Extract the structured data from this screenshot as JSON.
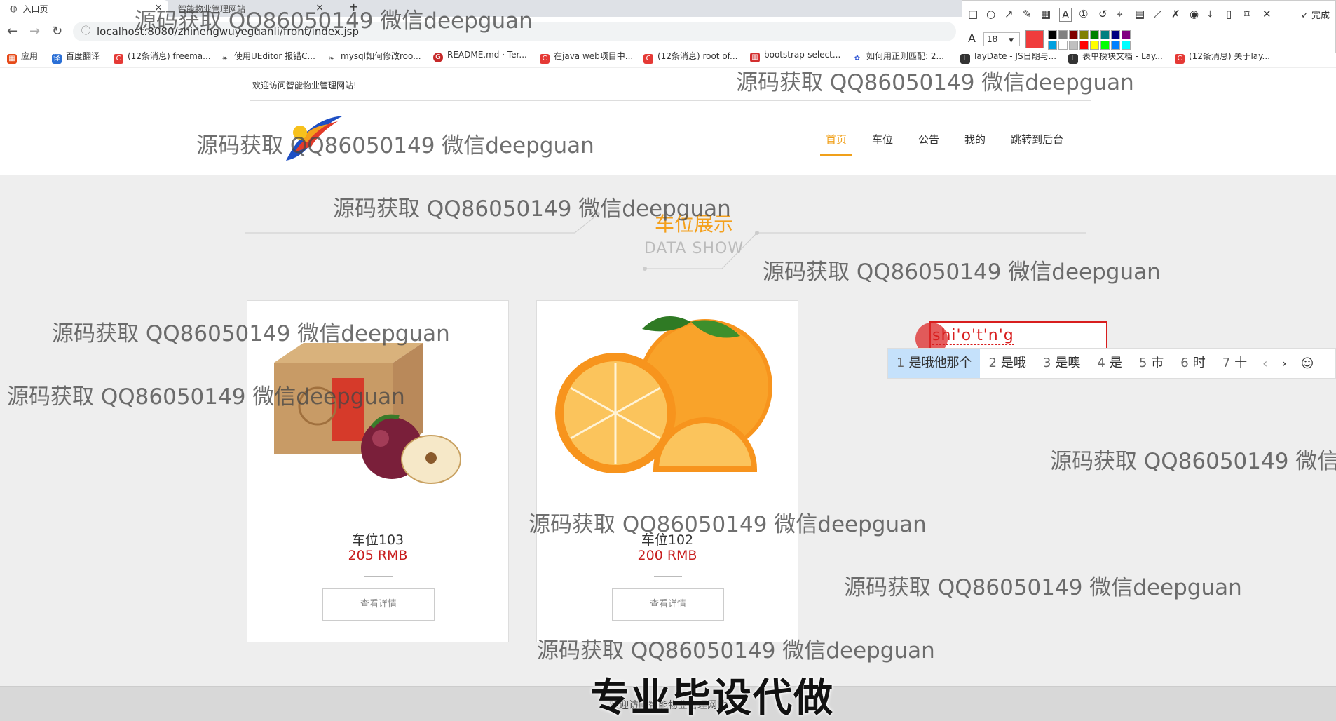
{
  "browser": {
    "tabs": [
      {
        "title": "入口页"
      },
      {
        "title": "智能物业管理网站"
      }
    ],
    "new_tab_label": "+",
    "url": "localhost:8080/zhinengwuyeguanli/front/index.jsp",
    "bookmarks": [
      {
        "label": "应用",
        "icon": "apps-icon",
        "color": "#e64a19"
      },
      {
        "label": "百度翻译",
        "icon": "translate-icon",
        "color": "#2a6fd6"
      },
      {
        "label": "(12条消息) freema...",
        "icon": "csdn-icon",
        "color": "#e53935"
      },
      {
        "label": "使用UEditor 报错C...",
        "icon": "leaf-icon",
        "color": "#555555"
      },
      {
        "label": "mysql如何修改roo...",
        "icon": "leaf-icon",
        "color": "#555555"
      },
      {
        "label": "README.md · Ter...",
        "icon": "gitee-icon",
        "color": "#c62828"
      },
      {
        "label": "在java web项目中...",
        "icon": "csdn-icon",
        "color": "#e53935"
      },
      {
        "label": "(12条消息) root of...",
        "icon": "csdn-icon",
        "color": "#e53935"
      },
      {
        "label": "bootstrap-select...",
        "icon": "cnblogs-icon",
        "color": "#d32f2f"
      },
      {
        "label": "如何用正则匹配: 2...",
        "icon": "baidu-icon",
        "color": "#2f55d4"
      },
      {
        "label": "layDate - JS日期与...",
        "icon": "layui-icon",
        "color": "#333333"
      },
      {
        "label": "表单模块文档 - Lay...",
        "icon": "layui-icon",
        "color": "#333333"
      },
      {
        "label": "(12条消息) 关于lay...",
        "icon": "csdn-icon",
        "color": "#e53935"
      }
    ],
    "snip_toolbar": {
      "font_size": "18",
      "current_color": "#f03c3c",
      "done_label": "完成",
      "palette": [
        "#000000",
        "#808080",
        "#800000",
        "#808000",
        "#008000",
        "#008080",
        "#000080",
        "#800080",
        "#00a0e0",
        "#ffffff",
        "#c0c0c0",
        "#ff0000",
        "#ffff00",
        "#00ff00",
        "#0080ff",
        "#00ffff"
      ]
    }
  },
  "site": {
    "welcome": "欢迎访问智能物业管理网站!",
    "nav": [
      {
        "label": "首页",
        "active": true
      },
      {
        "label": "车位"
      },
      {
        "label": "公告"
      },
      {
        "label": "我的"
      },
      {
        "label": "跳转到后台"
      }
    ],
    "section_title": "车位展示",
    "section_subtitle": "DATA SHOW",
    "cards": [
      {
        "title": "车位103",
        "price": "205 RMB",
        "button": "查看详情",
        "image": "apple-gift-box"
      },
      {
        "title": "车位102",
        "price": "200 RMB",
        "button": "查看详情",
        "image": "oranges"
      }
    ],
    "footer": "欢迎访问智能物业管理网站"
  },
  "ime": {
    "composition": "shi'o't'n'g",
    "candidates": [
      {
        "num": "1",
        "text": "是哦他那个"
      },
      {
        "num": "2",
        "text": "是哦"
      },
      {
        "num": "3",
        "text": "是噢"
      },
      {
        "num": "4",
        "text": "是"
      },
      {
        "num": "5",
        "text": "市"
      },
      {
        "num": "6",
        "text": "时"
      },
      {
        "num": "7",
        "text": "十"
      }
    ]
  },
  "watermark": "源码获取 QQ86050149 微信deepguan",
  "watermark_cut": "源码获取 QQ86050149 微信d",
  "slogan": "专业毕设代做"
}
